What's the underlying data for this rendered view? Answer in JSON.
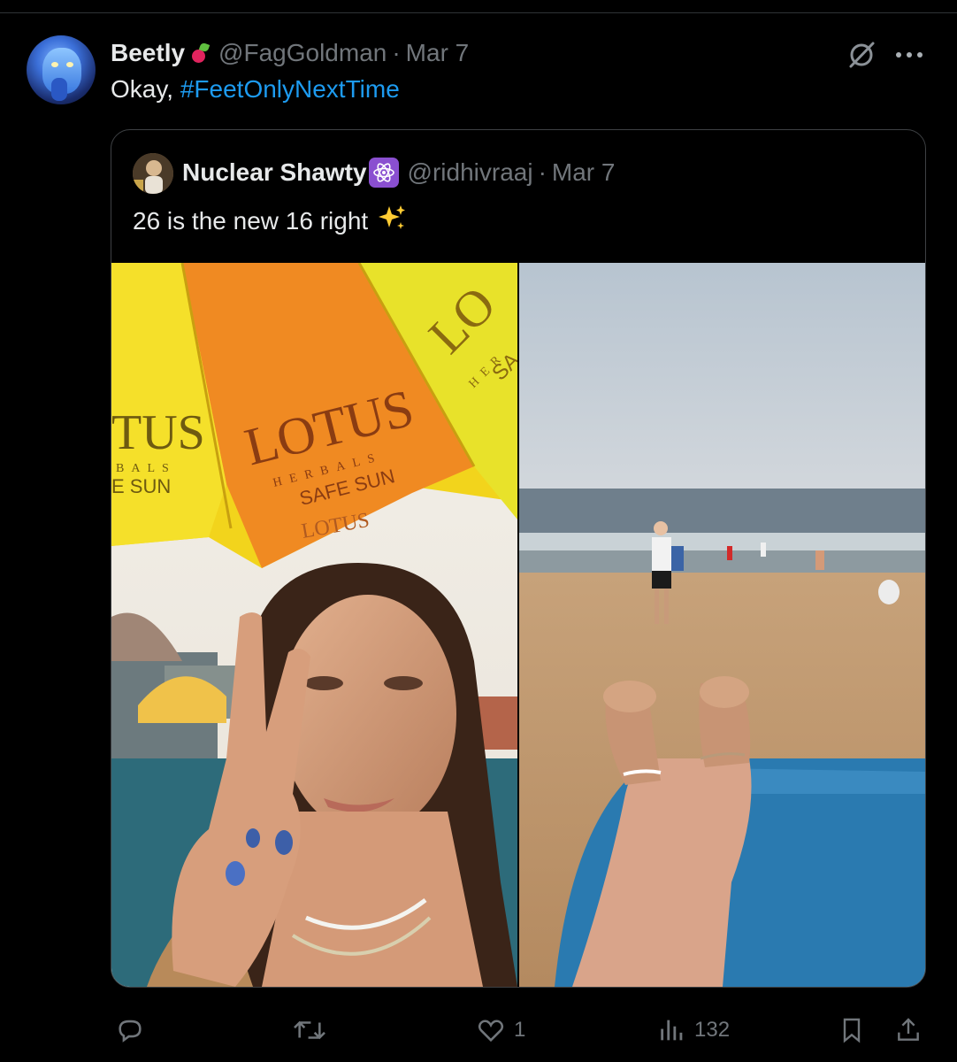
{
  "tweet": {
    "author_name": "Beetly",
    "author_emoji": "radish-icon",
    "handle": "@FagGoldman",
    "separator": "·",
    "date": "Mar 7",
    "text_prefix": "Okay, ",
    "hashtag": "#FeetOnlyNextTime"
  },
  "quoted": {
    "author_name": "Nuclear Shawty",
    "author_emoji": "atom-icon",
    "handle": "@ridhivraaj",
    "separator": "·",
    "date": "Mar 7",
    "text": "26 is the new 16 right",
    "text_emoji": "sparkles-icon",
    "media": {
      "left_umbrella_brand": "LOTUS",
      "left_umbrella_line1": "HERBALS",
      "left_umbrella_line2": "SAFE SUN",
      "left_umbrella_small": "LOTUS",
      "left_umbrella_partial": "TUS",
      "left_umbrella_partial_line": "BALS",
      "left_umbrella_partial_sun": "E SUN",
      "right_umbrella_partial": "LO",
      "right_umbrella_partial_line": "HER",
      "right_umbrella_partial_sun": "SA"
    }
  },
  "actions": {
    "reply_icon": "reply-icon",
    "retweet_icon": "retweet-icon",
    "like_icon": "heart-icon",
    "like_count": "1",
    "views_icon": "views-icon",
    "views_count": "132",
    "bookmark_icon": "bookmark-icon",
    "share_icon": "share-icon"
  },
  "colors": {
    "background": "#000000",
    "text": "#e7e9ea",
    "muted": "#71767b",
    "accent": "#1d9bf0",
    "border": "#2f3336"
  }
}
